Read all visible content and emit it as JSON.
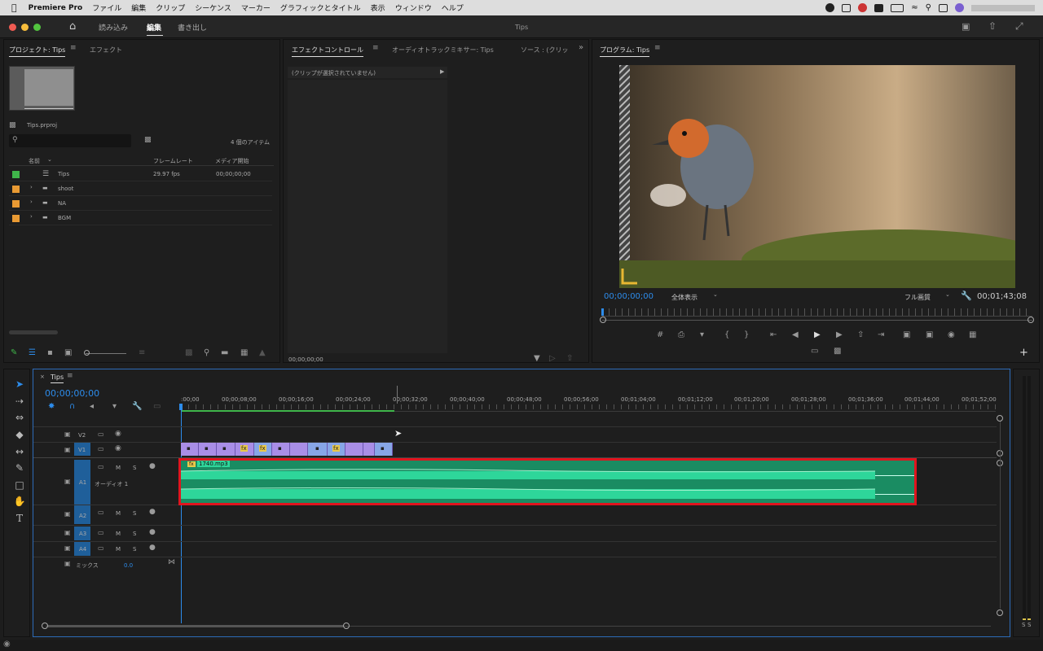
{
  "menubar": {
    "app": "Premiere Pro",
    "items": [
      "ファイル",
      "編集",
      "クリップ",
      "シーケンス",
      "マーカー",
      "グラフィックとタイトル",
      "表示",
      "ウィンドウ",
      "ヘルプ"
    ]
  },
  "titlebar": {
    "title": "Tips",
    "workspaces": [
      "読み込み",
      "編集",
      "書き出し"
    ]
  },
  "project": {
    "tab": "プロジェクト: Tips",
    "tab2": "エフェクト",
    "file": "Tips.prproj",
    "count": "4 個のアイテム",
    "cols": [
      "名前",
      "フレームレート",
      "メディア開始"
    ],
    "items": [
      {
        "name": "Tips",
        "fps": "29.97 fps",
        "start": "00;00;00;00",
        "color": "#3fb54a"
      },
      {
        "name": "shoot",
        "fps": "",
        "start": "",
        "color": "#e99a33"
      },
      {
        "name": "NA",
        "fps": "",
        "start": "",
        "color": "#e99a33"
      },
      {
        "name": "BGM",
        "fps": "",
        "start": "",
        "color": "#e99a33"
      }
    ]
  },
  "effects": {
    "tab": "エフェクトコントロール",
    "tab2": "オーディオトラックミキサー: Tips",
    "tab3": "ソース : (クリッ",
    "noclip": "(クリップが選択されていません)",
    "time": "00;00;00;00"
  },
  "program": {
    "tab": "プログラム: Tips",
    "timecode": "00;00;00;00",
    "fit": "全体表示",
    "quality": "フル画質",
    "duration": "00;01;43;08"
  },
  "timeline": {
    "tab": "Tips",
    "timecode": "00;00;00;00",
    "ruler": [
      ":00;00",
      "00;00;08;00",
      "00;00;16;00",
      "00;00;24;00",
      "00;00;32;00",
      "00;00;40;00",
      "00;00;48;00",
      "00;00;56;00",
      "00;01;04;00",
      "00;01;12;00",
      "00;01;20;00",
      "00;01;28;00",
      "00;01;36;00",
      "00;01;44;00",
      "00;01;52;00"
    ],
    "tracks": {
      "v2": "V2",
      "v1": "V1",
      "a1": "A1",
      "a1name": "オーディオ 1",
      "a2": "A2",
      "a3": "A3",
      "a4": "A4",
      "mix": "ミックス",
      "mixval": "0.0",
      "m": "M",
      "s": "S"
    },
    "audioclip": "1740.mp3",
    "fx": "fx"
  },
  "meter": {
    "s1": "S",
    "s2": "S"
  },
  "colors": {
    "accent": "#2d8ceb",
    "highlight": "#e0141e",
    "audio": "#28c88a",
    "video": "#a98ee6"
  }
}
